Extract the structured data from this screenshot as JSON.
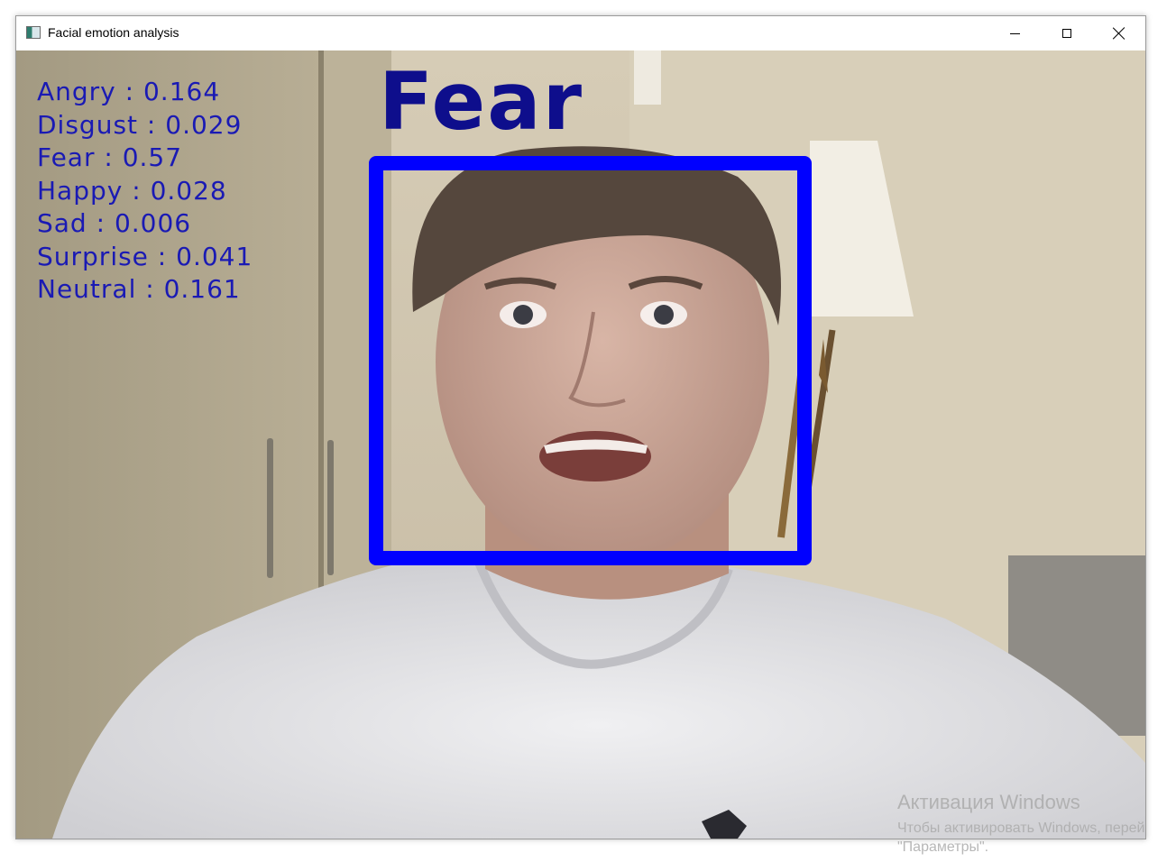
{
  "window": {
    "title": "Facial emotion analysis",
    "controls": {
      "minimize": "minimize",
      "maximize": "maximize",
      "close": "close"
    }
  },
  "overlay": {
    "detected_emotion": "Fear",
    "scores": [
      "Angry : 0.164",
      "Disgust : 0.029",
      "Fear : 0.57",
      "Happy : 0.028",
      "Sad : 0.006",
      "Surprise : 0.041",
      "Neutral : 0.161"
    ],
    "colors": {
      "box": "#0000ff",
      "label": "#0e0e8c",
      "scores_text": "#1a1ab4"
    }
  },
  "watermark": {
    "title": "Активация Windows",
    "line1": "Чтобы активировать Windows, перей",
    "line2": "\"Параметры\"."
  }
}
